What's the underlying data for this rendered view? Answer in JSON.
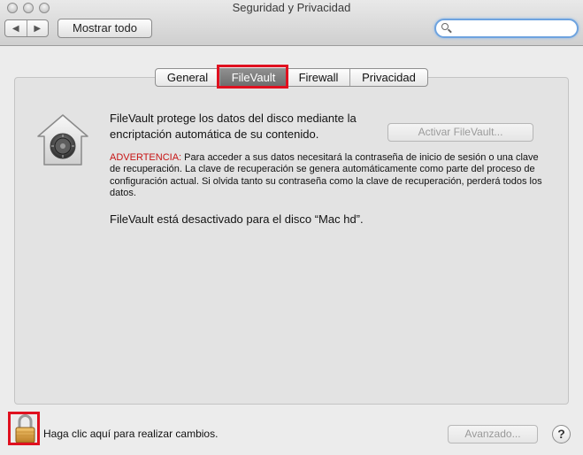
{
  "window": {
    "title": "Seguridad y Privacidad",
    "back_icon": "triangle-left",
    "forward_icon": "triangle-right",
    "show_all_label": "Mostrar todo",
    "search": {
      "value": "",
      "placeholder": ""
    }
  },
  "tabs": [
    {
      "label": "General",
      "selected": false
    },
    {
      "label": "FileVault",
      "selected": true
    },
    {
      "label": "Firewall",
      "selected": false
    },
    {
      "label": "Privacidad",
      "selected": false
    }
  ],
  "filevault": {
    "description": "FileVault protege los datos del disco mediante la encriptación automática de su contenido.",
    "activate_button": "Activar FileVault...",
    "warning_label": "ADVERTENCIA:",
    "warning_text": " Para acceder a sus datos necesitará la contraseña de inicio de sesión o una clave de recuperación. La clave de recuperación se genera automáticamente como parte del proceso de configuración actual. Si olvida tanto su contraseña como la clave de recuperación, perderá todos los datos.",
    "status": "FileVault está desactivado para el disco “Mac hd”."
  },
  "footer": {
    "lock_text": "Haga clic aquí para realizar cambios.",
    "advanced_button": "Avanzado...",
    "help_button": "?"
  },
  "colors": {
    "highlight": "#e0101f",
    "warning": "#c71414",
    "selected_tab": "#7a7a7a",
    "search_focus": "#6ea3df"
  }
}
